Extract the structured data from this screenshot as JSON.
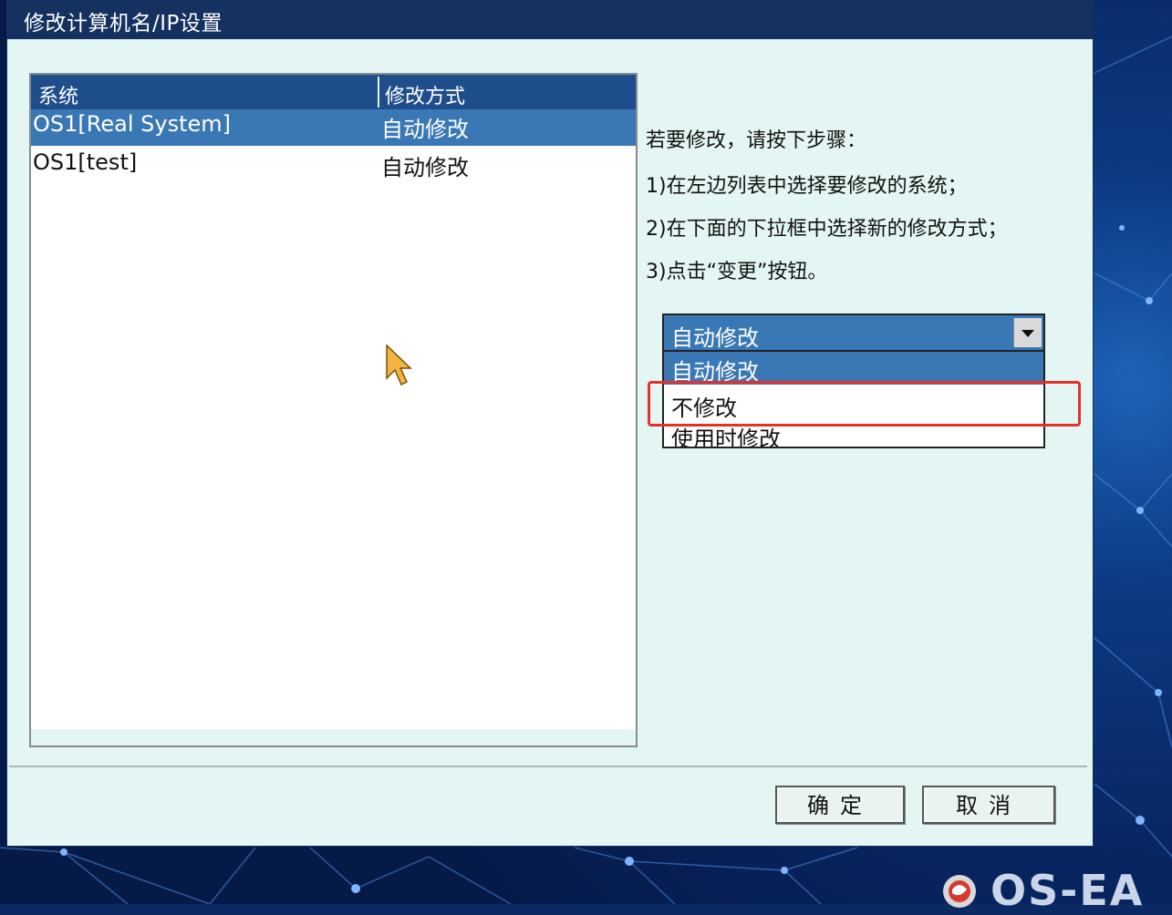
{
  "dialog": {
    "title": "修改计算机名/IP设置"
  },
  "list": {
    "headers": {
      "system": "系统",
      "mode": "修改方式"
    },
    "rows": [
      {
        "system": "OS1[Real System]",
        "mode": "自动修改",
        "selected": true
      },
      {
        "system": "OS1[test]",
        "mode": "自动修改",
        "selected": false
      }
    ]
  },
  "instructions": {
    "heading": "若要修改，请按下步骤：",
    "step1": "1)在左边列表中选择要修改的系统；",
    "step2": "2)在下面的下拉框中选择新的修改方式；",
    "step3": "3)点击“变更”按钮。"
  },
  "combo": {
    "selected": "自动修改",
    "options": [
      "自动修改",
      "不修改",
      "使用时修改"
    ],
    "highlighted_option": "不修改"
  },
  "buttons": {
    "ok": "确定",
    "cancel": "取消"
  },
  "branding": {
    "logo_text": "OS-EA"
  },
  "colors": {
    "title_bar": "#14315f",
    "selection": "#3a78b5",
    "dialog_bg": "#e3f6f4",
    "highlight_box": "#e5302b"
  }
}
